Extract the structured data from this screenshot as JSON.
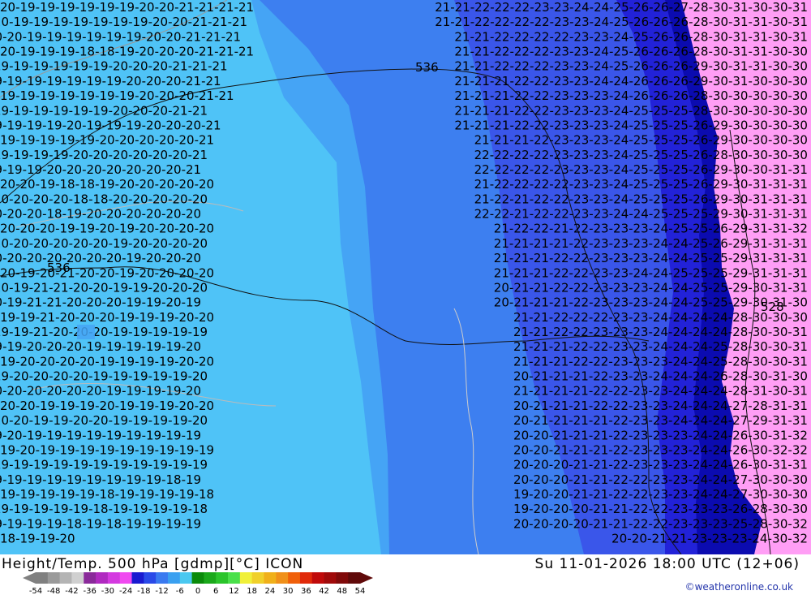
{
  "map": {
    "annotations": [
      "536",
      "536",
      "528"
    ],
    "fill_colors": {
      "light_cyan": "#4fc3f7",
      "sky_blue": "#45a4f5",
      "mid_blue": "#3d7ff0",
      "blue": "#3a56ea",
      "deep_blue": "#2222d8",
      "navy": "#0b0bb0",
      "pink": "#ff9ef5"
    },
    "rows": [
      {
        "left": "20 19 19 19 19 19 19 20 20 21 21 21 21",
        "right": "21 21 22 22 22 23 23 24 24 25 26 26 27 28 30 31 30 30 31"
      },
      {
        "left": "20 19 19 19 19 19 19 19 20 20 21 21 21",
        "right": "21 21 22 22 22 22 23 23 24 25 26 26 26 28 30 31 31 30 31"
      },
      {
        "left": "20 20 19 19 19 19 19 19 20 20 21 21 21",
        "right": "21 21 22 22 22 22 23 23 24 25 26 26 28 30 31 31 30 31"
      },
      {
        "left": "20 19 19 19 18 18 19 20 20 20 21 21 21",
        "right": "21 21 22 22 22 23 23 24 25 26 26 26 28 30 31 31 30 30"
      },
      {
        "left": "19 19 19 19 19 19 20 20 20 21 21 21",
        "right": "21 21 22 22 22 23 23 24 25 26 26 26 29 30 31 31 30 30"
      },
      {
        "left": "19 19 19 19 19 19 19 20 20 20 21 21",
        "right": "21 21 21 22 22 23 23 24 24 26 26 26 29 30 31 30 30 30"
      },
      {
        "left": "19 19 19 19 19 19 19 20 20 20 21 21",
        "right": "21 21 21 22 22 23 23 23 24 26 26 26 28 30 30 30 30 30"
      },
      {
        "left": "19 19 19 19 19 19 20 20 20 21 21",
        "right": "21 21 21 22 22 23 23 23 24 25 25 25 28 30 30 30 30 30"
      },
      {
        "left": "19 19 19 19 20 19 19 19 20 20 20 21",
        "right": "21 21 21 22 22 23 23 23 24 25 25 25 26 29 30 30 30 30"
      },
      {
        "left": "19 19 19 19 19 20 20 20 20 20 21",
        "right": "21 21 21 22 23 23 23 24 25 25 25 26 29 30 30 30 30"
      },
      {
        "left": "19 19 19 19 20 20 20 20 20 20 21",
        "right": "22 22 22 22 23 23 23 24 25 25 25 26 28 30 30 30 30"
      },
      {
        "left": "19 19 19 20 20 20 20 20 20 20 21",
        "right": "22 22 22 22 23 23 23 24 25 25 25 26 29 30 30 31 31"
      },
      {
        "left": "20 20 19 18 18 19 20 20 20 20 20",
        "right": "21 22 22 22 22 23 23 24 25 25 25 26 29 30 31 31 31"
      },
      {
        "left": "20 20 20 20 18 18 20 20 20 20 20",
        "right": "21 22 21 22 22 23 23 24 25 25 25 26 29 30 31 31 31"
      },
      {
        "left": "20 20 20 18 19 20 20 20 20 20 20",
        "right": "22 22 21 22 22 23 23 24 24 25 25 25 29 30 31 31 31"
      },
      {
        "left": "20 20 20 19 19 20 19 20 20 20 20",
        "right": "21 22 22 21 22 23 23 23 24 25 25 26 29 31 31 32"
      },
      {
        "left": "20 20 20 20 20 20 19 20 20 20 20",
        "right": "21 21 21 21 22 23 23 23 24 24 25 26 29 31 31 31"
      },
      {
        "left": "20 20 20 20 20 20 20 19 20 20 20",
        "right": "21 21 21 22 22 23 23 23 24 24 25 25 29 31 31 31"
      },
      {
        "left": "20 19 20 21 20 20 19 20 20 20 20",
        "right": "21 21 21 22 22 23 23 24 24 25 25 25 29 31 31 31"
      },
      {
        "left": "20 19 21 21 20 20 19 19 20 20 20",
        "right": "20 21 21 22 22 23 23 23 24 24 25 25 29 30 31 31"
      },
      {
        "left": "20 19 21 21 20 20 20 19 19 20 19",
        "right": "20 21 21 21 22 23 23 23 24 24 25 25 29 30 31 30"
      },
      {
        "left": "19 19 21 20 20 20 19 19 19 20 20",
        "right": "21 21 22 22 22 23 23 24 24 24 24 28 30 30 30"
      },
      {
        "left": "19 19 21 20 20 20 19 19 19 19 19",
        "right": "21 21 22 22 23 23 23 24 24 24 24 28 30 30 31"
      },
      {
        "left": "19 19 20 20 20 19 19 19 19 19 20",
        "right": "21 21 21 22 22 23 23 24 24 24 25 28 30 30 31"
      },
      {
        "left": "19 20 20 20 20 19 19 19 19 20 20",
        "right": "21 21 21 22 22 23 23 23 24 24 25 28 30 30 31"
      },
      {
        "left": "19 20 20 20 20 19 19 19 19 19 20",
        "right": "20 21 21 21 22 23 23 24 24 24 26 28 30 31 30"
      },
      {
        "left": "20 20 20 20 20 20 19 19 19 19 20",
        "right": "21 21 21 21 22 22 23 23 24 24 24 28 31 30 31"
      },
      {
        "left": "20 20 19 19 19 20 19 19 19 20 20",
        "right": "20 21 21 21 22 22 23 23 24 24 24 27 28 31 31"
      },
      {
        "left": "20 20 19 19 20 20 19 19 19 19 20",
        "right": "20 21 21 21 21 22 23 23 24 24 24 27 29 31 31"
      },
      {
        "left": "19 20 19 19 19 19 19 19 19 19 19",
        "right": "20 20 21 21 21 22 23 23 23 24 24 26 30 31 32"
      },
      {
        "left": "19 20 19 19 19 19 19 19 19 19 19",
        "right": "20 20 21 21 21 22 23 23 23 24 24 26 30 32 32"
      },
      {
        "left": "19 19 19 19 19 19 19 19 19 19 19",
        "right": "20 20 20 21 21 22 23 23 23 24 24 26 30 31 31"
      },
      {
        "left": "19 19 19 19 19 19 19 19 19 18 19",
        "right": "20 20 20 21 21 22 22 23 23 24 24 27 30 30 30"
      },
      {
        "left": "19 19 19 19 19 18 19 19 19 19 18",
        "right": "19 20 20 21 21 22 22 23 23 24 24 27 30 30 30"
      },
      {
        "left": "19 19 19 19 19 18 19 19 19 19 18",
        "right": "19 20 20 20 21 21 22 22 23 23 23 26 28 30 30"
      },
      {
        "left": "19 19 19 19 18 19 18 19 19 19 19",
        "right": "20 20 20 20 21 21 22 22 23 23 23 25 28 30 32"
      },
      {
        "left": "18 19 19 20",
        "right": "20 20 21 21 23 23 23 24 30 32"
      }
    ]
  },
  "footer": {
    "title": "Height/Temp. 500 hPa [gdmp][°C] ICON",
    "valid": "Su 11-01-2026 18:00 UTC (12+06)",
    "credit": "©weatheronline.co.uk",
    "scale_ticks": [
      "-54",
      "-48",
      "-42",
      "-36",
      "-30",
      "-24",
      "-18",
      "-12",
      "-6",
      "0",
      "6",
      "12",
      "18",
      "24",
      "30",
      "36",
      "42",
      "48",
      "54"
    ],
    "scale_colors": [
      "#808080",
      "#9a9a9a",
      "#b4b4b4",
      "#d0d0d0",
      "#8a2a9a",
      "#b02ac0",
      "#d43ae0",
      "#f04af0",
      "#1a1ad0",
      "#2a4ae8",
      "#3a7af0",
      "#3aa0f0",
      "#4ac8f0",
      "#0a8a0a",
      "#1aa81a",
      "#2ac42a",
      "#4ae04a",
      "#f0f03a",
      "#f0d02a",
      "#f0b01a",
      "#f0901a",
      "#f0600a",
      "#e02a0a",
      "#c00a0a",
      "#a00a0a",
      "#800a0a",
      "#600a0a"
    ]
  }
}
